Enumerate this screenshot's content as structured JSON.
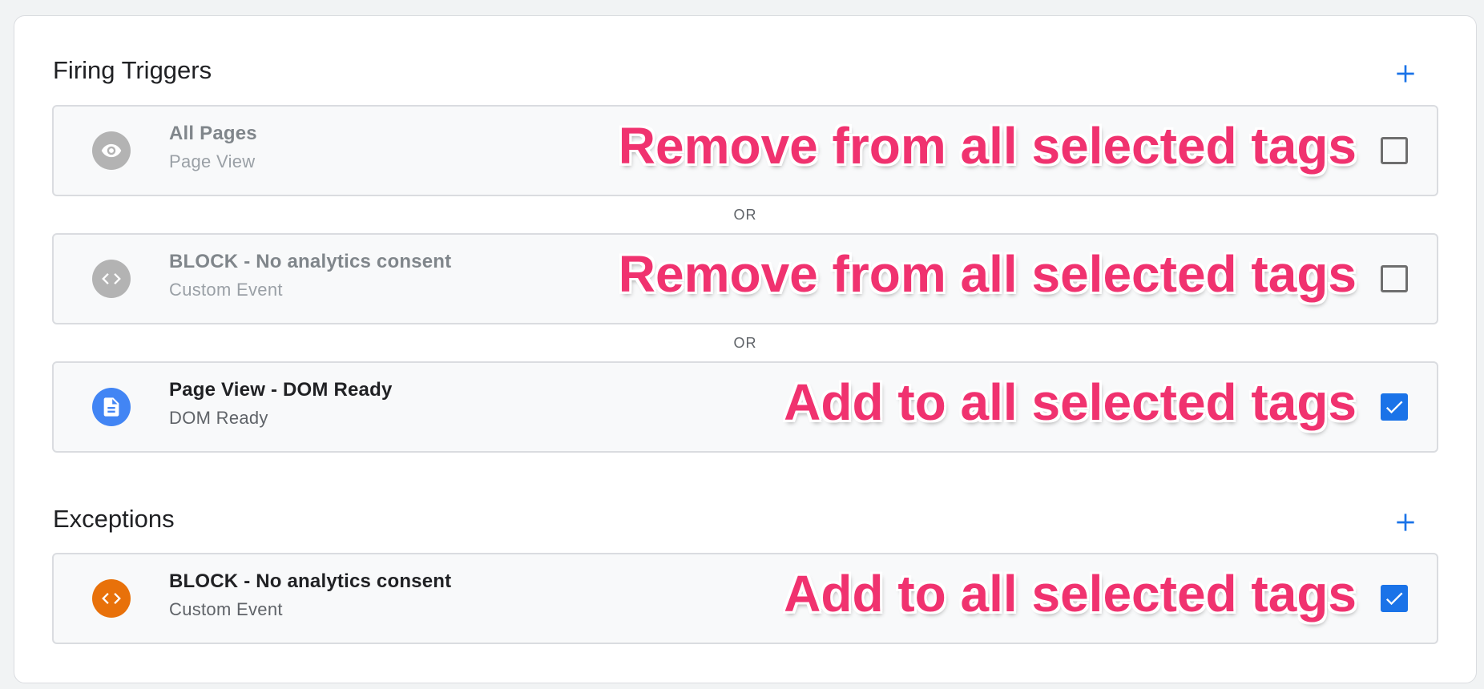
{
  "firing": {
    "title": "Firing Triggers",
    "or_label": "OR",
    "triggers": [
      {
        "name": "All Pages",
        "type": "Page View",
        "icon": "eye-icon",
        "icon_color": "#b3b3b3",
        "annotation": "Remove from all selected tags",
        "checked": false
      },
      {
        "name": "BLOCK - No analytics consent",
        "type": "Custom Event",
        "icon": "code-icon",
        "icon_color": "#b3b3b3",
        "annotation": "Remove from all selected tags",
        "checked": false
      },
      {
        "name": "Page View - DOM Ready",
        "type": "DOM Ready",
        "icon": "document-icon",
        "icon_color": "#4285f4",
        "annotation": "Add to all selected tags",
        "checked": true
      }
    ]
  },
  "exceptions": {
    "title": "Exceptions",
    "triggers": [
      {
        "name": "BLOCK - No analytics consent",
        "type": "Custom Event",
        "icon": "code-icon",
        "icon_color": "#e8710a",
        "annotation": "Add to all selected tags",
        "checked": true
      }
    ]
  },
  "colors": {
    "accent": "#1a73e8",
    "annotation": "#f0326f"
  }
}
